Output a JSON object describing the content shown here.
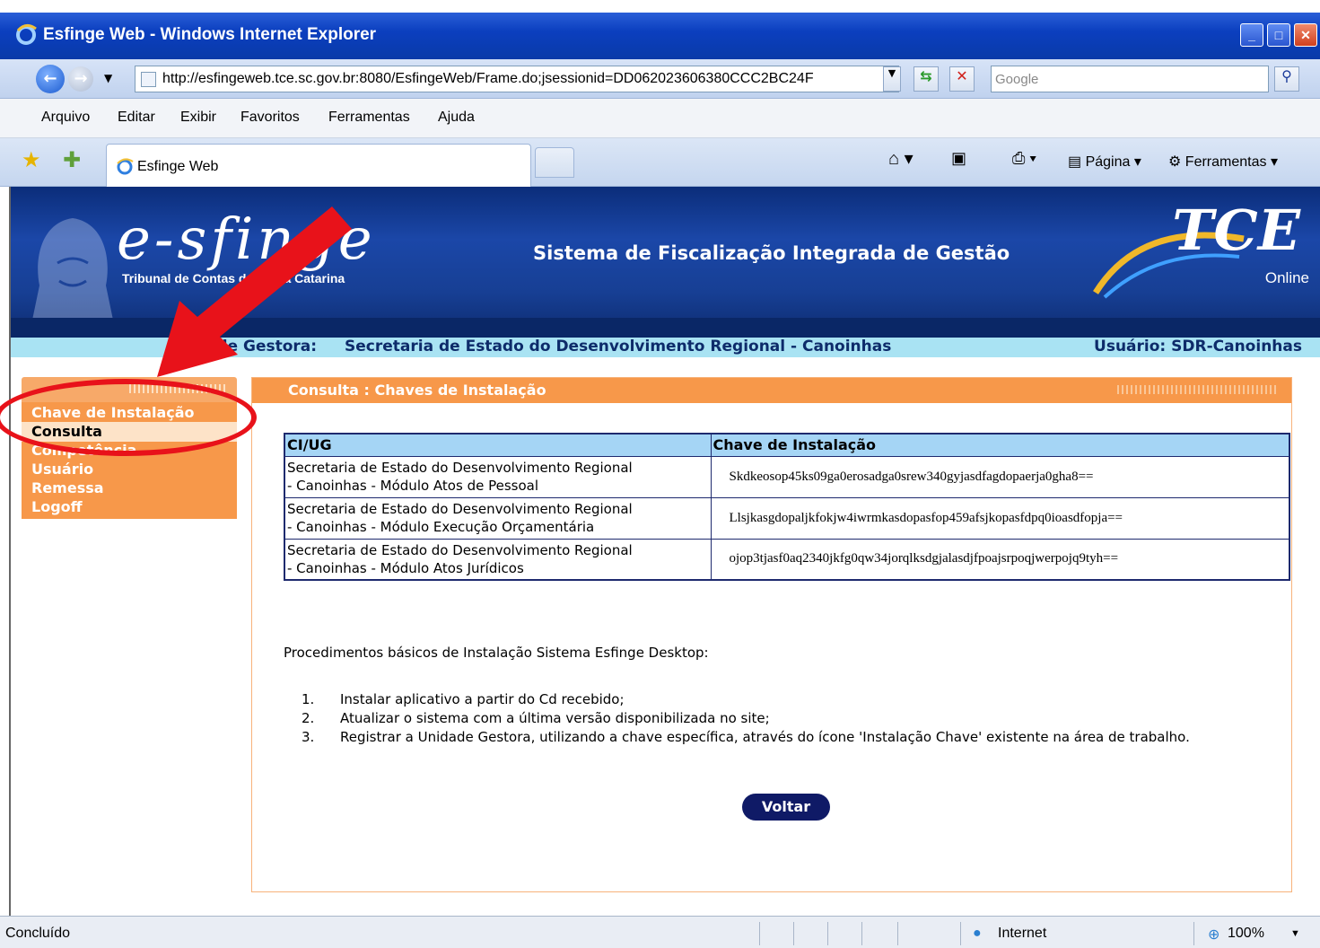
{
  "window": {
    "title": "Esfinge Web - Windows Internet Explorer"
  },
  "address": {
    "url": "http://esfingeweb.tce.sc.gov.br:8080/EsfingeWeb/Frame.do;jsessionid=DD062023606380CCC2BC24F",
    "search_placeholder": "Google"
  },
  "menu": [
    "Arquivo",
    "Editar",
    "Exibir",
    "Favoritos",
    "Ferramentas",
    "Ajuda"
  ],
  "tab": {
    "label": "Esfinge Web"
  },
  "commands": {
    "page": "Página",
    "tools": "Ferramentas"
  },
  "banner": {
    "logo_text": "e-sfinge",
    "logo_subtitle": "Tribunal de Contas de Santa Catarina",
    "title": "Sistema de Fiscalização Integrada de Gestão",
    "tce": "TCE",
    "tce_sub": "Online"
  },
  "ug_bar": {
    "label": "Unidade Gestora:",
    "value": "Secretaria de Estado do Desenvolvimento Regional - Canoinhas",
    "user": "Usuário: SDR-Canoinhas"
  },
  "sidebar": {
    "items": [
      {
        "label": "Chave de Instalação"
      },
      {
        "label": "Consulta"
      },
      {
        "label": "Competência"
      },
      {
        "label": "Usuário"
      },
      {
        "label": "Remessa"
      },
      {
        "label": "Logoff"
      }
    ]
  },
  "panel": {
    "title": "Consulta : Chaves de Instalação",
    "table": {
      "headers": [
        "CI/UG",
        "Chave de Instalação"
      ],
      "rows": [
        {
          "ug_line1": "Secretaria de Estado do Desenvolvimento Regional",
          "ug_line2": "- Canoinhas - Módulo Atos de Pessoal",
          "key": "Skdkeosop45ks09ga0erosadga0srew340gyjasdfagdopaerja0gha8=="
        },
        {
          "ug_line1": "Secretaria de Estado do Desenvolvimento Regional",
          "ug_line2": "- Canoinhas - Módulo Execução Orçamentária",
          "key": "Llsjkasgdopaljkfokjw4iwrmkasdopasfop459afsjkopasfdpq0ioasdfopja=="
        },
        {
          "ug_line1": "Secretaria de Estado do Desenvolvimento Regional",
          "ug_line2": "- Canoinhas - Módulo Atos Jurídicos",
          "key": "ojop3tjasf0aq2340jkfg0qw34jorqlksdgjalasdjfpoajsrpoqjwerpojq9tyh=="
        }
      ]
    },
    "procedures_title": "Procedimentos básicos de Instalação Sistema Esfinge Desktop:",
    "steps": [
      {
        "n": "1.",
        "text": "Instalar aplicativo a partir do Cd recebido;"
      },
      {
        "n": "2.",
        "text": "Atualizar o sistema com a última versão disponibilizada no site;"
      },
      {
        "n": "3.",
        "text": "Registrar a Unidade Gestora, utilizando a chave específica, através do ícone 'Instalação Chave' existente na área de trabalho."
      }
    ],
    "back_button": "Voltar"
  },
  "status": {
    "text": "Concluído",
    "zone": "Internet",
    "zoom": "100%"
  },
  "colors": {
    "orange": "#f7984a",
    "navy": "#0f1a66",
    "annotation_red": "#e8121a",
    "ug_bar": "#a9e3f3"
  }
}
